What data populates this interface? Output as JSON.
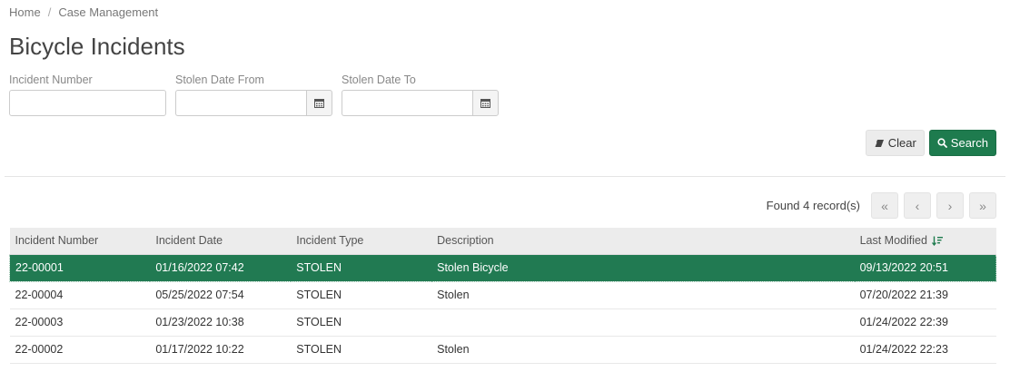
{
  "breadcrumb": {
    "home": "Home",
    "separator": "/",
    "current": "Case Management"
  },
  "page": {
    "title": "Bicycle Incidents"
  },
  "filters": {
    "incident_number": {
      "label": "Incident Number",
      "value": ""
    },
    "stolen_from": {
      "label": "Stolen Date From",
      "value": ""
    },
    "stolen_to": {
      "label": "Stolen Date To",
      "value": ""
    }
  },
  "actions": {
    "clear_label": "Clear",
    "search_label": "Search"
  },
  "pager": {
    "count_text": "Found 4 record(s)",
    "first": "«",
    "prev": "‹",
    "next": "›",
    "last": "»"
  },
  "table": {
    "columns": [
      "Incident Number",
      "Incident Date",
      "Incident Type",
      "Description",
      "Last Modified"
    ],
    "sorted_column": "Last Modified",
    "rows": [
      {
        "number": "22-00001",
        "date": "01/16/2022 07:42",
        "type": "STOLEN",
        "description": "Stolen Bicycle",
        "modified": "09/13/2022 20:51",
        "selected": true
      },
      {
        "number": "22-00004",
        "date": "05/25/2022 07:54",
        "type": "STOLEN",
        "description": "Stolen",
        "modified": "07/20/2022 21:39",
        "selected": false
      },
      {
        "number": "22-00003",
        "date": "01/23/2022 10:38",
        "type": "STOLEN",
        "description": "",
        "modified": "01/24/2022 22:39",
        "selected": false
      },
      {
        "number": "22-00002",
        "date": "01/17/2022 10:22",
        "type": "STOLEN",
        "description": "Stolen",
        "modified": "01/24/2022 22:23",
        "selected": false
      }
    ]
  },
  "colors": {
    "primary_green": "#1e7b4e",
    "selected_row": "#217a52",
    "header_bg": "#ececec"
  },
  "icons": {
    "calendar": "calendar-icon",
    "eraser": "eraser-icon",
    "search": "search-icon",
    "sort": "sort-desc-icon"
  }
}
